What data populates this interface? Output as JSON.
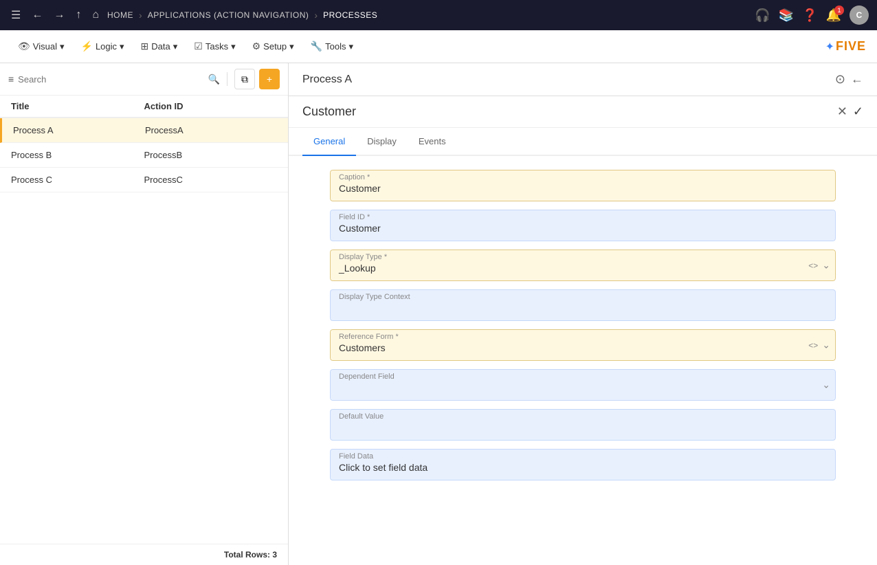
{
  "topNav": {
    "breadcrumbs": [
      {
        "label": "HOME",
        "active": false
      },
      {
        "label": "APPLICATIONS (ACTION NAVIGATION)",
        "active": false
      },
      {
        "label": "PROCESSES",
        "active": true
      }
    ],
    "avatar": "C",
    "notif_count": "1"
  },
  "toolbar": {
    "items": [
      {
        "label": "Visual",
        "icon": "👁"
      },
      {
        "label": "Logic",
        "icon": "⚡"
      },
      {
        "label": "Data",
        "icon": "⊞"
      },
      {
        "label": "Tasks",
        "icon": "☑"
      },
      {
        "label": "Setup",
        "icon": "⚙"
      },
      {
        "label": "Tools",
        "icon": "🔧"
      }
    ],
    "logo_text": "FIVE"
  },
  "sidebar": {
    "search_placeholder": "Search",
    "columns": [
      "Title",
      "Action ID"
    ],
    "rows": [
      {
        "title": "Process A",
        "actionId": "ProcessA",
        "active": true
      },
      {
        "title": "Process B",
        "actionId": "ProcessB",
        "active": false
      },
      {
        "title": "Process C",
        "actionId": "ProcessC",
        "active": false
      }
    ],
    "footer": "Total Rows: 3"
  },
  "contentHeader": {
    "title": "Process A",
    "back_icon": "↩",
    "sync_icon": "↻"
  },
  "form": {
    "title": "Customer",
    "tabs": [
      {
        "label": "General",
        "active": true
      },
      {
        "label": "Display",
        "active": false
      },
      {
        "label": "Events",
        "active": false
      }
    ],
    "fields": [
      {
        "name": "caption",
        "label": "Caption *",
        "value": "Customer",
        "type": "highlighted",
        "has_actions": false
      },
      {
        "name": "field_id",
        "label": "Field ID *",
        "value": "Customer",
        "type": "light-blue",
        "has_actions": false
      },
      {
        "name": "display_type",
        "label": "Display Type *",
        "value": "_Lookup",
        "type": "highlighted",
        "has_actions": true,
        "has_arrow": true
      },
      {
        "name": "display_type_context",
        "label": "Display Type Context",
        "value": "",
        "type": "light-blue",
        "has_actions": false
      },
      {
        "name": "reference_form",
        "label": "Reference Form *",
        "value": "Customers",
        "type": "highlighted",
        "has_actions": true,
        "has_arrow": true
      },
      {
        "name": "dependent_field",
        "label": "Dependent Field",
        "value": "",
        "type": "light-blue",
        "has_actions": true,
        "dropdown_only": true
      },
      {
        "name": "default_value",
        "label": "Default Value",
        "value": "",
        "type": "light-blue",
        "has_actions": false
      },
      {
        "name": "field_data",
        "label": "Field Data",
        "value": "Click to set field data",
        "type": "light-blue",
        "has_actions": false
      }
    ]
  },
  "icons": {
    "menu": "☰",
    "back": "←",
    "forward": "→",
    "up": "↑",
    "home": "⌂",
    "chevron": "›",
    "search": "🔍",
    "filter": "≡",
    "add": "+",
    "copy": "⧉",
    "close": "✕",
    "check": "✓",
    "sync": "⊙",
    "arrow_back": "←",
    "code": "<>",
    "dropdown": "⌄",
    "help": "?",
    "notif": "🔔",
    "books": "📚",
    "headset": "🎧"
  }
}
